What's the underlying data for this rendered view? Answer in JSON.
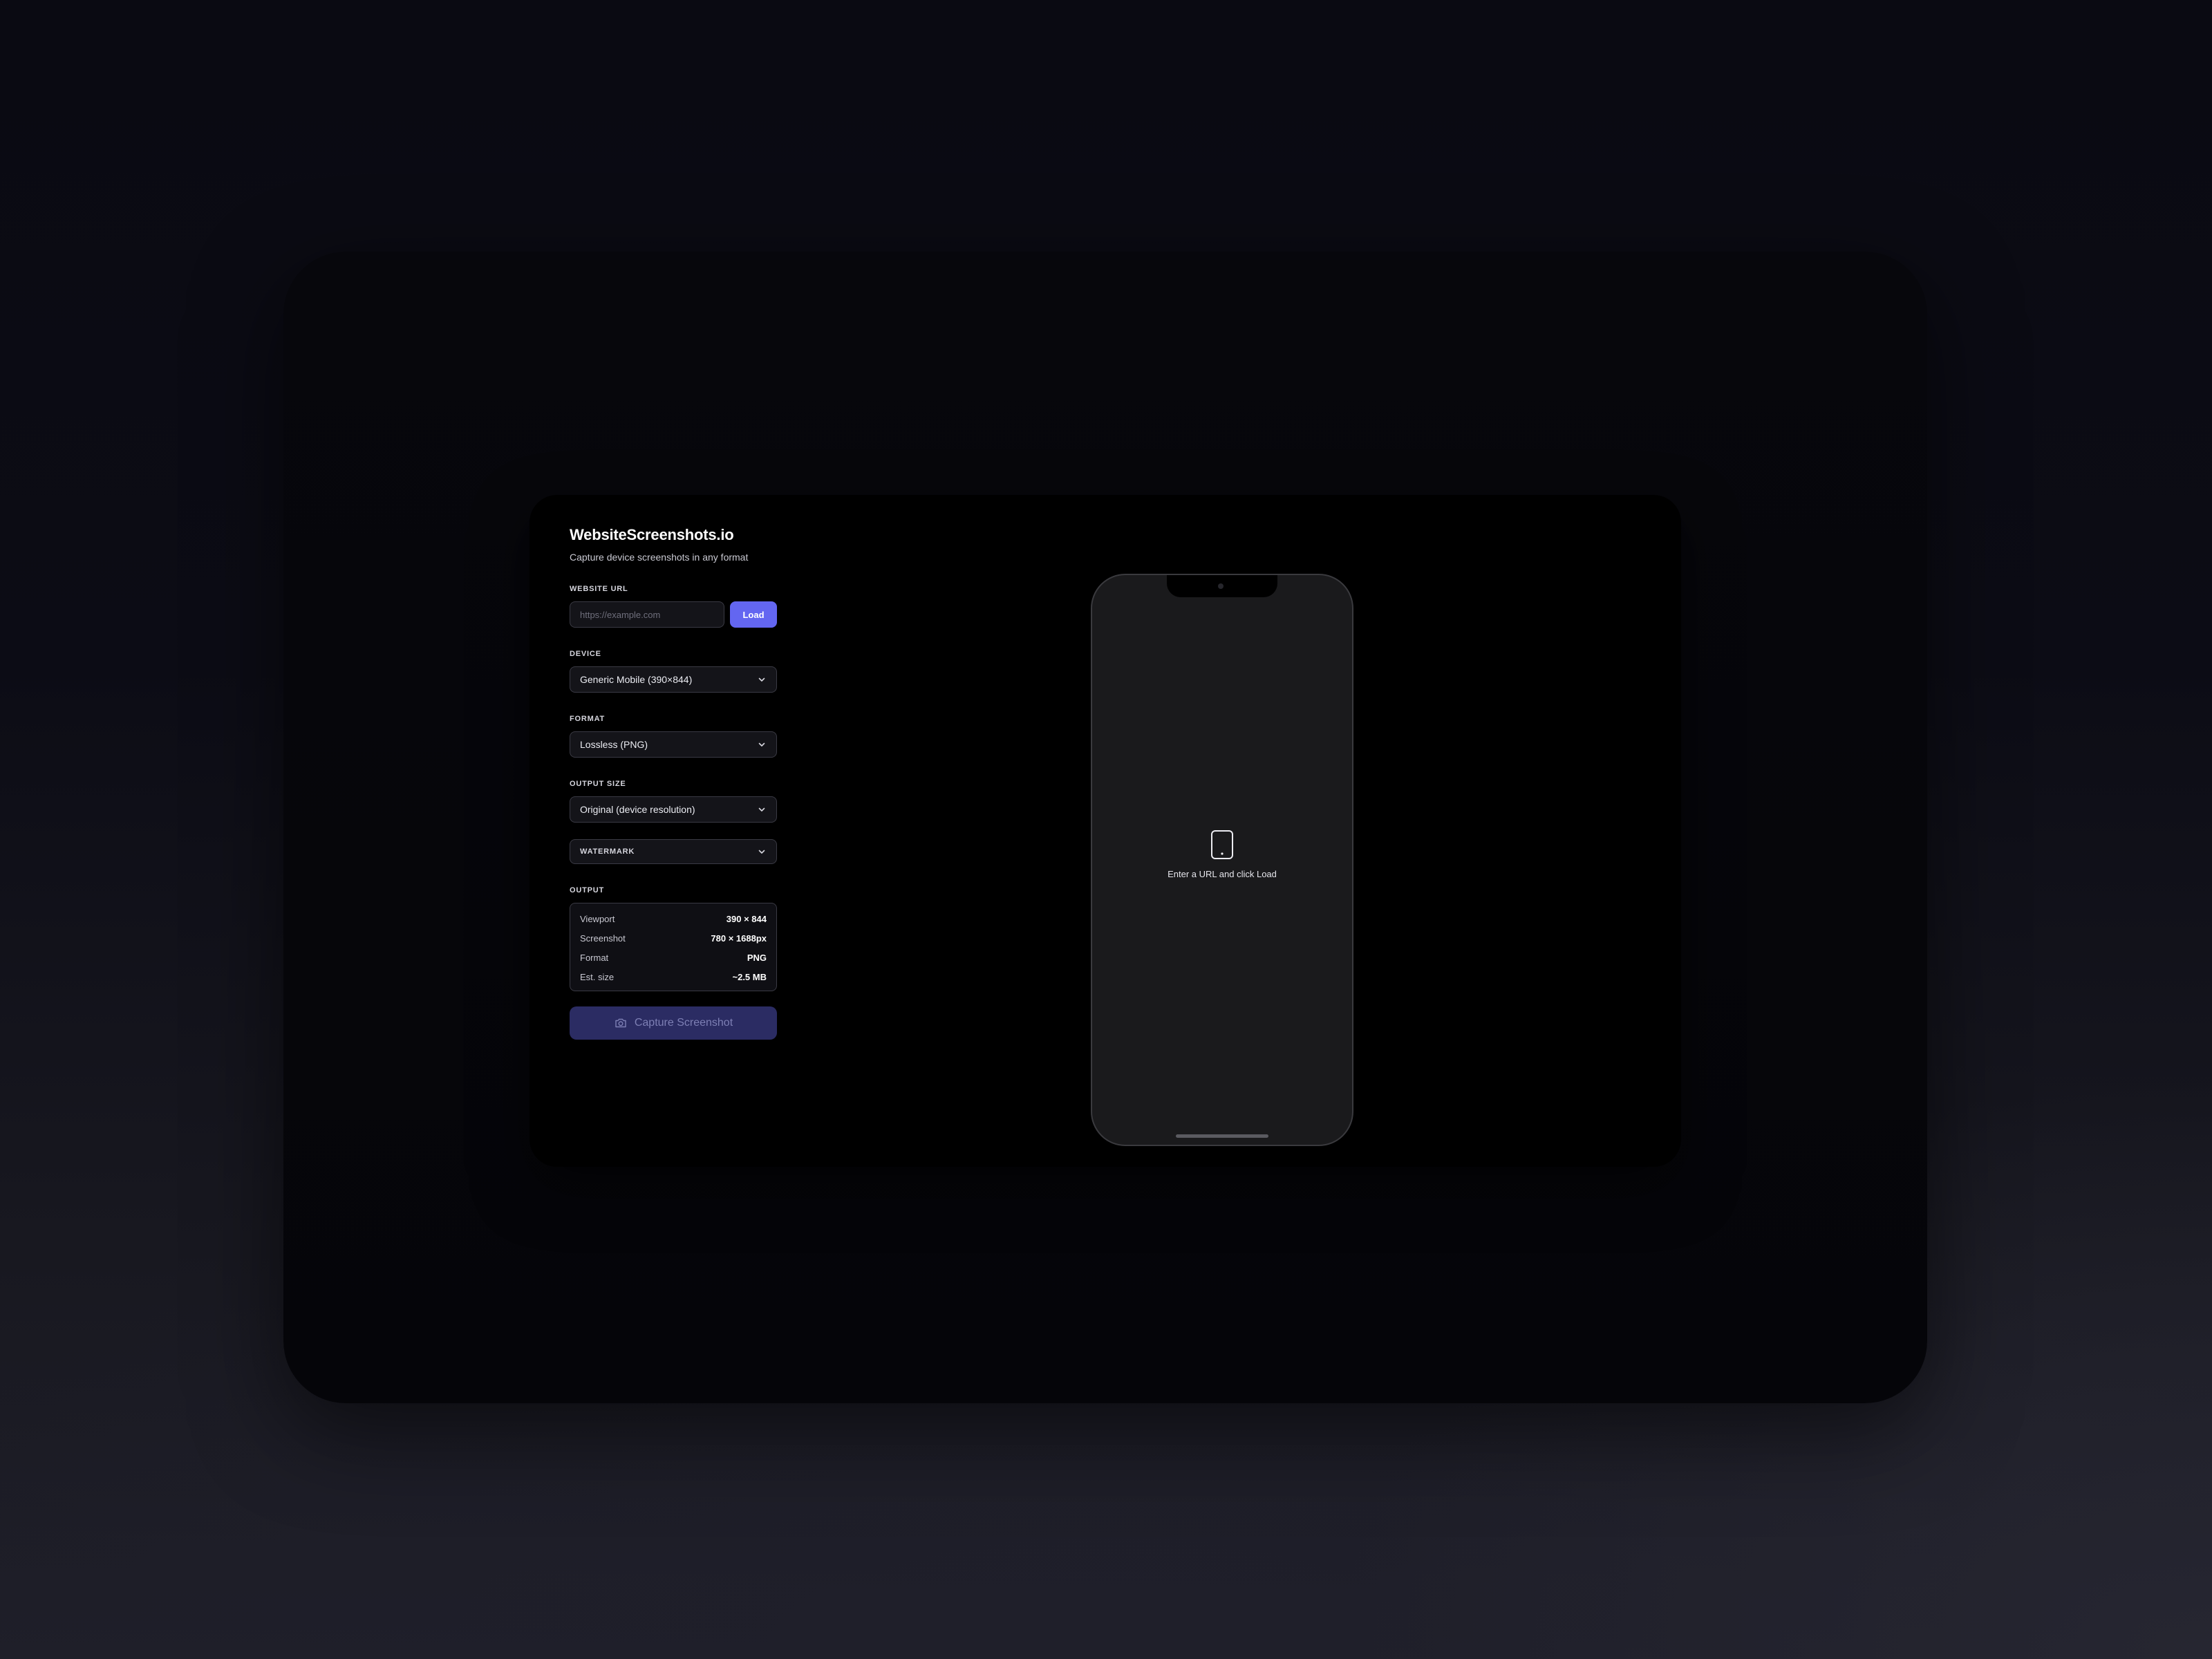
{
  "app": {
    "title": "WebsiteScreenshots.io",
    "subtitle": "Capture device screenshots in any format"
  },
  "url_field": {
    "label": "WEBSITE URL",
    "value": "",
    "placeholder": "https://example.com",
    "load_label": "Load"
  },
  "device": {
    "label": "DEVICE",
    "selected": "Generic Mobile (390×844)"
  },
  "format": {
    "label": "FORMAT",
    "selected": "Lossless (PNG)"
  },
  "output_size": {
    "label": "OUTPUT SIZE",
    "selected": "Original (device resolution)"
  },
  "watermark": {
    "label": "WATERMARK"
  },
  "output": {
    "label": "OUTPUT",
    "rows": [
      {
        "key": "Viewport",
        "value": "390 × 844"
      },
      {
        "key": "Screenshot",
        "value": "780 × 1688px"
      },
      {
        "key": "Format",
        "value": "PNG"
      },
      {
        "key": "Est. size",
        "value": "~2.5 MB"
      }
    ]
  },
  "capture_button": {
    "label": "Capture Screenshot"
  },
  "preview": {
    "empty_message": "Enter a URL and click Load"
  },
  "icons": {
    "chevron": "chevron-down-icon",
    "camera": "camera-icon",
    "device": "mobile-device-icon"
  },
  "colors": {
    "accent": "#6366f1",
    "capture_disabled": "#2b2c63",
    "panel_bg": "#000000",
    "phone_screen": "#1a1a1c"
  }
}
